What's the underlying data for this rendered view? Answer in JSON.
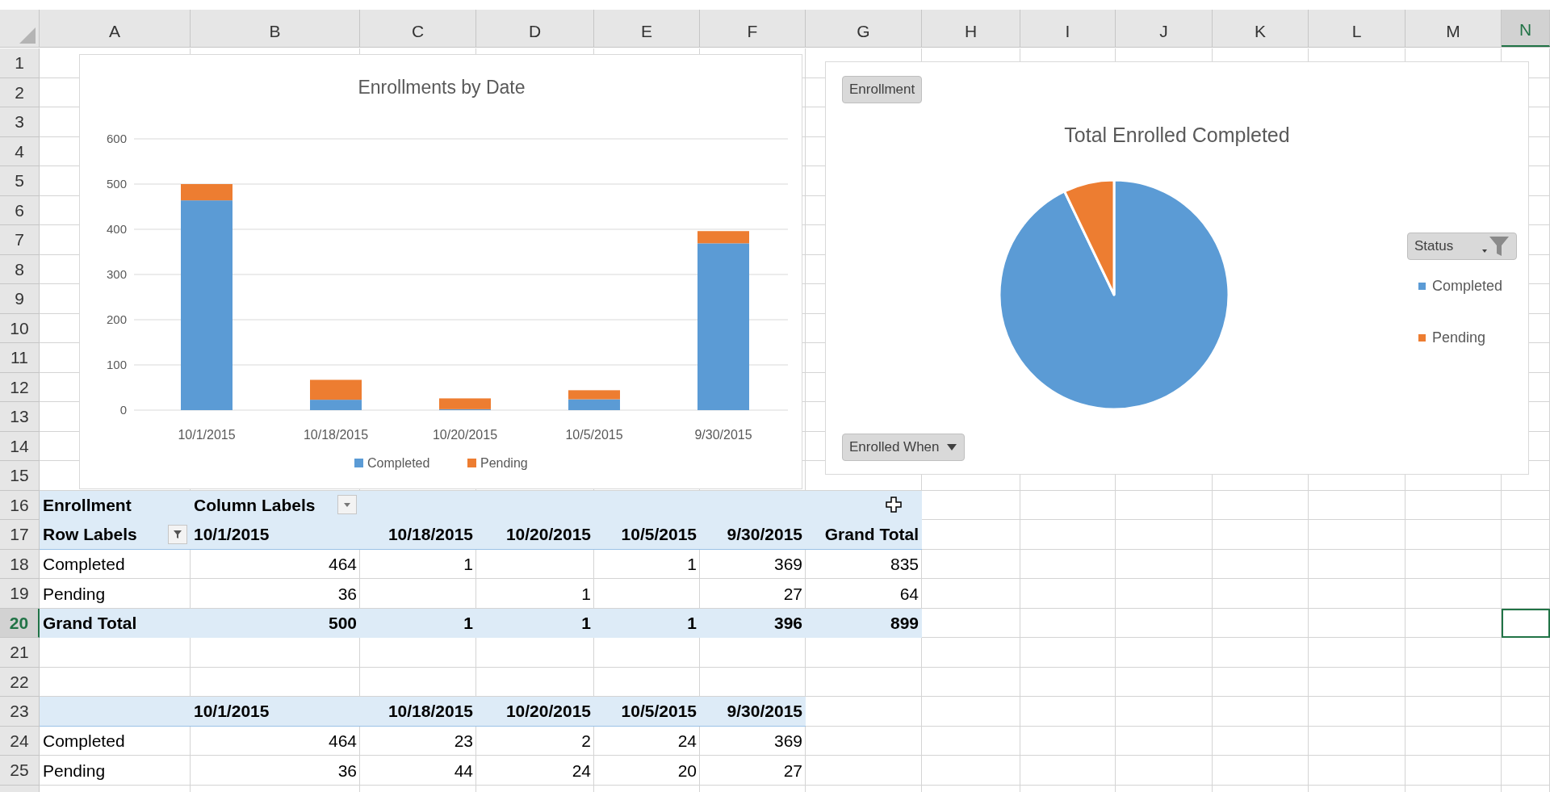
{
  "columns": [
    {
      "label": "A",
      "selected": false
    },
    {
      "label": "B",
      "selected": false
    },
    {
      "label": "C",
      "selected": false
    },
    {
      "label": "D",
      "selected": false
    },
    {
      "label": "E",
      "selected": false
    },
    {
      "label": "F",
      "selected": false
    },
    {
      "label": "G",
      "selected": false
    },
    {
      "label": "H",
      "selected": false
    },
    {
      "label": "I",
      "selected": false
    },
    {
      "label": "J",
      "selected": false
    },
    {
      "label": "K",
      "selected": false
    },
    {
      "label": "L",
      "selected": false
    },
    {
      "label": "M",
      "selected": false
    },
    {
      "label": "N",
      "selected": true
    }
  ],
  "rows": [
    {
      "label": "1",
      "selected": false
    },
    {
      "label": "2",
      "selected": false
    },
    {
      "label": "3",
      "selected": false
    },
    {
      "label": "4",
      "selected": false
    },
    {
      "label": "5",
      "selected": false
    },
    {
      "label": "6",
      "selected": false
    },
    {
      "label": "7",
      "selected": false
    },
    {
      "label": "8",
      "selected": false
    },
    {
      "label": "9",
      "selected": false
    },
    {
      "label": "10",
      "selected": false
    },
    {
      "label": "11",
      "selected": false
    },
    {
      "label": "12",
      "selected": false
    },
    {
      "label": "13",
      "selected": false
    },
    {
      "label": "14",
      "selected": false
    },
    {
      "label": "15",
      "selected": false
    },
    {
      "label": "16",
      "selected": false
    },
    {
      "label": "17",
      "selected": false
    },
    {
      "label": "18",
      "selected": false
    },
    {
      "label": "19",
      "selected": false
    },
    {
      "label": "20",
      "selected": true
    },
    {
      "label": "21",
      "selected": false
    },
    {
      "label": "22",
      "selected": false
    },
    {
      "label": "23",
      "selected": false
    },
    {
      "label": "24",
      "selected": false
    },
    {
      "label": "25",
      "selected": false
    }
  ],
  "bar_chart": {
    "chart_data": {
      "type": "bar",
      "title": "Enrollments by Date",
      "categories": [
        "10/1/2015",
        "10/18/2015",
        "10/20/2015",
        "10/5/2015",
        "9/30/2015"
      ],
      "series": [
        {
          "name": "Completed",
          "color": "#5b9bd5",
          "values": [
            464,
            23,
            2,
            24,
            369
          ]
        },
        {
          "name": "Pending",
          "color": "#ed7d31",
          "values": [
            36,
            44,
            24,
            20,
            27
          ]
        }
      ],
      "ylim": [
        0,
        600
      ],
      "yticks": [
        0,
        100,
        200,
        300,
        400,
        500,
        600
      ],
      "stacked": true,
      "orientation": "vertical",
      "grid": true,
      "legend": true
    }
  },
  "pie_chart": {
    "filter_button": "Enrollment",
    "axis_button": "Enrolled When",
    "legend_button": "Status",
    "chart_data": {
      "type": "pie",
      "title": "Total Enrolled Completed",
      "categories": [
        "Completed",
        "Pending"
      ],
      "values": [
        92.88,
        7.12
      ],
      "legend": true
    }
  },
  "pivot_table": {
    "data_field": "Enrollment",
    "column_labels": "Column Labels",
    "row_labels": "Row Labels",
    "columns": [
      "10/1/2015",
      "10/18/2015",
      "10/20/2015",
      "10/5/2015",
      "9/30/2015",
      "Grand Total"
    ],
    "rows": [
      {
        "label": "Completed",
        "cells": [
          {
            "text": "464"
          },
          {
            "text": "1"
          },
          {},
          {
            "text": "1"
          },
          {
            "text": "369"
          },
          {
            "text": "835"
          }
        ]
      },
      {
        "label": "Pending",
        "cells": [
          {
            "text": "36"
          },
          {},
          {
            "text": "1"
          },
          {},
          {
            "text": "27"
          },
          {
            "text": "64"
          }
        ]
      }
    ],
    "grand_total": {
      "label": "Grand Total",
      "cells": [
        {
          "text": "500"
        },
        {
          "text": "1"
        },
        {
          "text": "1"
        },
        {
          "text": "1"
        },
        {
          "text": "396"
        },
        {
          "text": "899"
        }
      ]
    }
  },
  "summary_table": {
    "columns": [
      "10/1/2015",
      "10/18/2015",
      "10/20/2015",
      "10/5/2015",
      "9/30/2015"
    ],
    "rows": [
      {
        "label": "Completed",
        "cells": [
          {
            "text": "464"
          },
          {
            "text": "23"
          },
          {
            "text": "2"
          },
          {
            "text": "24"
          },
          {
            "text": "369"
          }
        ]
      },
      {
        "label": "Pending",
        "cells": [
          {
            "text": "36"
          },
          {
            "text": "44"
          },
          {
            "text": "24"
          },
          {
            "text": "20"
          },
          {
            "text": "27"
          }
        ]
      }
    ]
  }
}
